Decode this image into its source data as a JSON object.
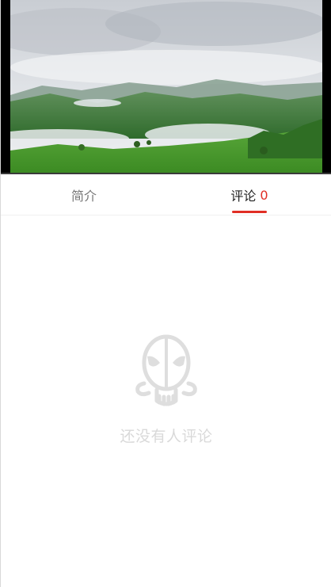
{
  "video": {
    "progress_fraction": 0.0
  },
  "tabs": {
    "intro_label": "简介",
    "comments_label": "评论",
    "comments_count": "0",
    "active": "comments"
  },
  "empty_state": {
    "icon": "deadpool-mask-icon",
    "message": "还没有人评论"
  },
  "colors": {
    "accent": "#e02e24",
    "muted_text": "#d9d9d9"
  }
}
